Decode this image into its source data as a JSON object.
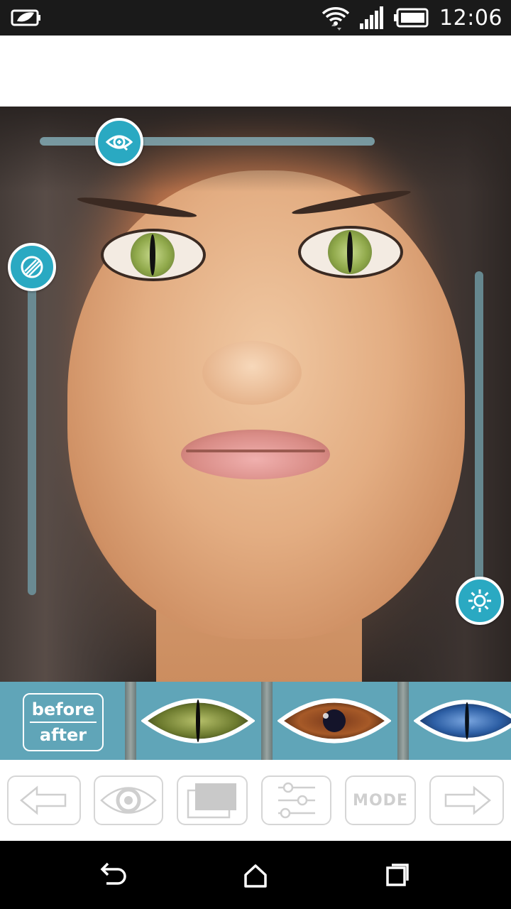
{
  "status_bar": {
    "time": "12:06",
    "icons": [
      "leaf-battery-saver-icon",
      "wifi-icon",
      "signal-icon",
      "battery-icon"
    ]
  },
  "photo": {
    "description_icons": {
      "size_slider": "eye-zoom-icon",
      "opacity_slider": "texture-icon",
      "brightness_slider": "brightness-icon"
    },
    "size_level": 0.24,
    "opacity_level": 0.0,
    "brightness_level": 1.0
  },
  "effects": {
    "before_label": "before",
    "after_label": "after",
    "lens_styles": [
      "green-cat-eye",
      "brown-eye",
      "blue-cat-eye"
    ]
  },
  "toolbar": {
    "mode_label": "MODE",
    "icons": [
      "arrow-left-icon",
      "eye-icon",
      "layers-icon",
      "sliders-icon",
      "mode-button",
      "arrow-right-icon"
    ]
  },
  "nav": {
    "icons": [
      "back-icon",
      "home-icon",
      "recents-icon"
    ]
  },
  "colors": {
    "accent": "#2aa9c2",
    "strip": "#60a5b8",
    "statusbar": "#1a1a1a"
  }
}
